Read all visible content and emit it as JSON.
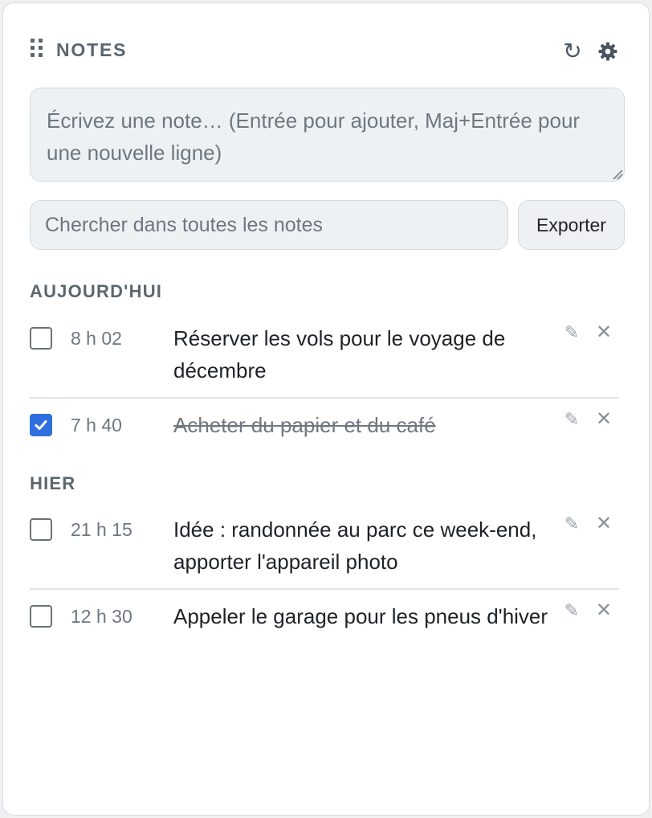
{
  "header": {
    "title": "NOTES",
    "drag_icon": "drag-handle-icon",
    "refresh_icon": "refresh-icon",
    "refresh_glyph": "↻",
    "settings_icon": "gear-icon"
  },
  "composer": {
    "placeholder": "Écrivez une note… (Entrée pour ajouter, Maj+Entrée pour une nouvelle ligne)",
    "value": ""
  },
  "search": {
    "placeholder": "Chercher dans toutes les notes",
    "value": ""
  },
  "toolbar": {
    "export_label": "Exporter"
  },
  "groups": [
    {
      "label": "AUJOURD'HUI",
      "notes": [
        {
          "time": "8 h 02",
          "text": "Réserver les vols pour le voyage de décembre",
          "checked": false
        },
        {
          "time": "7 h 40",
          "text": "Acheter du papier et du café",
          "checked": true
        }
      ]
    },
    {
      "label": "HIER",
      "notes": [
        {
          "time": "21 h 15",
          "text": "Idée : randonnée au parc ce week-end, apporter l'appareil photo",
          "checked": false
        },
        {
          "time": "12 h 30",
          "text": "Appeler le garage pour les pneus d'hiver",
          "checked": false
        }
      ]
    }
  ],
  "row_actions": {
    "edit_glyph": "✎",
    "edit_icon": "pencil-icon",
    "delete_glyph": "✕",
    "delete_icon": "close-icon"
  },
  "colors": {
    "accent": "#2f6fe0",
    "muted_text": "#6e7780",
    "heading_text": "#5c6670"
  }
}
